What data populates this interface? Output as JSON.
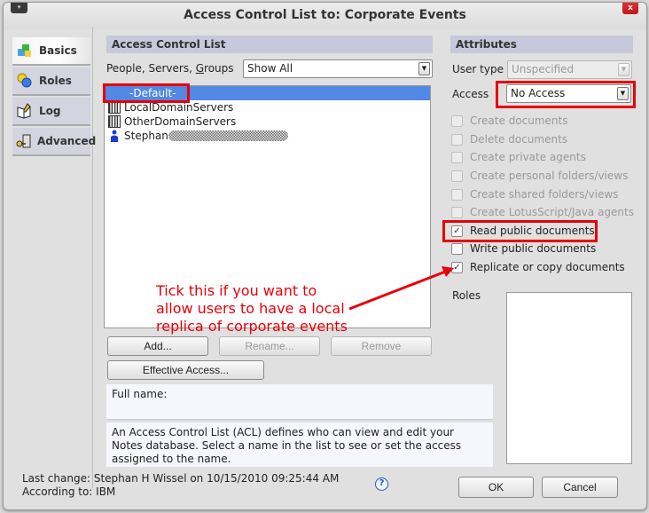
{
  "window": {
    "title": "Access Control List to: Corporate Events",
    "close_label": "x",
    "menu_label": "▾"
  },
  "sidebar": {
    "items": [
      {
        "label": "Basics",
        "icon": "basics-icon",
        "active": true
      },
      {
        "label": "Roles",
        "icon": "roles-masks-icon",
        "active": false
      },
      {
        "label": "Log",
        "icon": "log-book-icon",
        "active": false
      },
      {
        "label": "Advanced",
        "icon": "advanced-key-icon",
        "active": false
      }
    ]
  },
  "acl": {
    "header": "Access Control List",
    "filter_label_pre": "People, Servers, ",
    "filter_label_ul": "G",
    "filter_label_post": "roups",
    "filter_value": "Show All",
    "entries": [
      {
        "name": "-Default-",
        "icon": "none",
        "selected": true
      },
      {
        "name": "LocalDomainServers",
        "icon": "server-group-icon",
        "selected": false
      },
      {
        "name": "OtherDomainServers",
        "icon": "server-group-icon",
        "selected": false
      },
      {
        "name": "Stephan",
        "icon": "person-icon",
        "selected": false,
        "redacted_suffix": true
      }
    ],
    "buttons": {
      "add": "Add...",
      "rename": "Rename...",
      "remove": "Remove",
      "effective_access": "Effective Access..."
    },
    "full_name_label": "Full name:",
    "description": "An Access Control List (ACL) defines who can view and edit your Notes database.  Select a name in the list to see or set the access assigned to the name."
  },
  "attributes": {
    "header": "Attributes",
    "user_type_label": "User type",
    "user_type_value": "Unspecified",
    "access_label": "Access",
    "access_value": "No Access",
    "options": [
      {
        "label": "Create documents",
        "checked": false,
        "enabled": false
      },
      {
        "label": "Delete documents",
        "checked": false,
        "enabled": false
      },
      {
        "label": "Create private agents",
        "checked": false,
        "enabled": false
      },
      {
        "label": "Create personal folders/views",
        "checked": false,
        "enabled": false
      },
      {
        "label": "Create shared folders/views",
        "checked": false,
        "enabled": false
      },
      {
        "label": "Create LotusScript/Java agents",
        "checked": false,
        "enabled": false
      },
      {
        "label": "Read public documents",
        "checked": true,
        "enabled": true
      },
      {
        "label": "Write public documents",
        "checked": false,
        "enabled": true
      },
      {
        "label": "Replicate or copy documents",
        "checked": true,
        "enabled": true
      }
    ],
    "roles_label": "Roles"
  },
  "annotation": {
    "lines": [
      "Tick this if you want to",
      "allow users to have a local",
      "replica of corporate events"
    ],
    "color": "#e8000a"
  },
  "footer": {
    "last_change": "Last change: Stephan H Wissel on 10/15/2010 09:25:44 AM",
    "according_to": "According to: IBM",
    "help": "?",
    "ok": "OK",
    "cancel": "Cancel"
  }
}
